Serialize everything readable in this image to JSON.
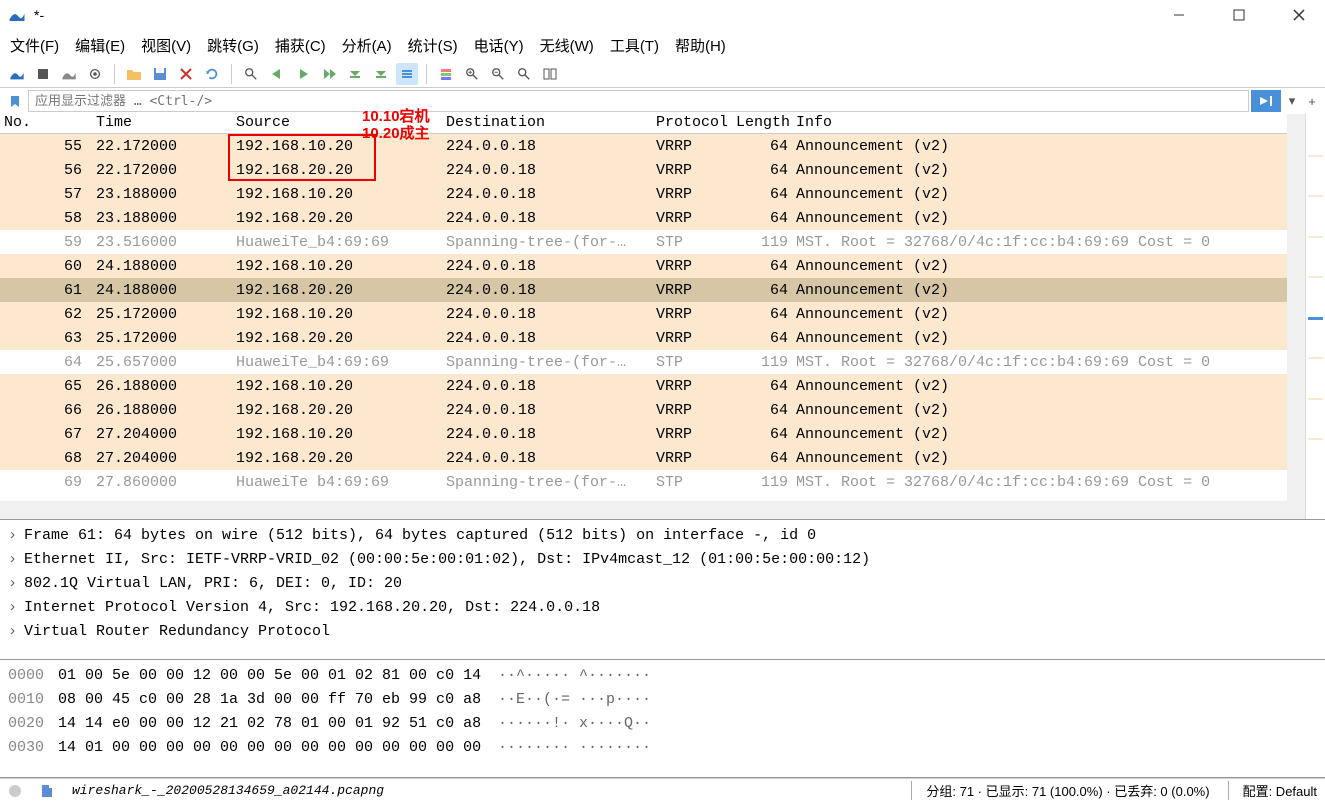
{
  "window": {
    "title": "*-"
  },
  "menu": [
    "文件(F)",
    "编辑(E)",
    "视图(V)",
    "跳转(G)",
    "捕获(C)",
    "分析(A)",
    "统计(S)",
    "电话(Y)",
    "无线(W)",
    "工具(T)",
    "帮助(H)"
  ],
  "filter": {
    "placeholder": "应用显示过滤器 … <Ctrl-/>"
  },
  "annotation1": "10.10宕机",
  "annotation2": "10.20成主",
  "columns": {
    "no": "No.",
    "time": "Time",
    "src": "Source",
    "dst": "Destination",
    "proto": "Protocol",
    "len": "Length",
    "info": "Info"
  },
  "packets": [
    {
      "no": 55,
      "time": "22.172000",
      "src": "192.168.10.20",
      "dst": "224.0.0.18",
      "proto": "VRRP",
      "len": 64,
      "info": "Announcement (v2)",
      "cls": "vrrp",
      "box": true
    },
    {
      "no": 56,
      "time": "22.172000",
      "src": "192.168.20.20",
      "dst": "224.0.0.18",
      "proto": "VRRP",
      "len": 64,
      "info": "Announcement (v2)",
      "cls": "vrrp",
      "box": true
    },
    {
      "no": 57,
      "time": "23.188000",
      "src": "192.168.10.20",
      "dst": "224.0.0.18",
      "proto": "VRRP",
      "len": 64,
      "info": "Announcement (v2)",
      "cls": "vrrp"
    },
    {
      "no": 58,
      "time": "23.188000",
      "src": "192.168.20.20",
      "dst": "224.0.0.18",
      "proto": "VRRP",
      "len": 64,
      "info": "Announcement (v2)",
      "cls": "vrrp"
    },
    {
      "no": 59,
      "time": "23.516000",
      "src": "HuaweiTe_b4:69:69",
      "dst": "Spanning-tree-(for-…",
      "proto": "STP",
      "len": 119,
      "info": "MST. Root = 32768/0/4c:1f:cc:b4:69:69  Cost = 0",
      "cls": "stp"
    },
    {
      "no": 60,
      "time": "24.188000",
      "src": "192.168.10.20",
      "dst": "224.0.0.18",
      "proto": "VRRP",
      "len": 64,
      "info": "Announcement (v2)",
      "cls": "vrrp"
    },
    {
      "no": 61,
      "time": "24.188000",
      "src": "192.168.20.20",
      "dst": "224.0.0.18",
      "proto": "VRRP",
      "len": 64,
      "info": "Announcement (v2)",
      "cls": "vrrp",
      "sel": true
    },
    {
      "no": 62,
      "time": "25.172000",
      "src": "192.168.10.20",
      "dst": "224.0.0.18",
      "proto": "VRRP",
      "len": 64,
      "info": "Announcement (v2)",
      "cls": "vrrp"
    },
    {
      "no": 63,
      "time": "25.172000",
      "src": "192.168.20.20",
      "dst": "224.0.0.18",
      "proto": "VRRP",
      "len": 64,
      "info": "Announcement (v2)",
      "cls": "vrrp"
    },
    {
      "no": 64,
      "time": "25.657000",
      "src": "HuaweiTe_b4:69:69",
      "dst": "Spanning-tree-(for-…",
      "proto": "STP",
      "len": 119,
      "info": "MST. Root = 32768/0/4c:1f:cc:b4:69:69  Cost = 0",
      "cls": "stp"
    },
    {
      "no": 65,
      "time": "26.188000",
      "src": "192.168.10.20",
      "dst": "224.0.0.18",
      "proto": "VRRP",
      "len": 64,
      "info": "Announcement (v2)",
      "cls": "vrrp"
    },
    {
      "no": 66,
      "time": "26.188000",
      "src": "192.168.20.20",
      "dst": "224.0.0.18",
      "proto": "VRRP",
      "len": 64,
      "info": "Announcement (v2)",
      "cls": "vrrp"
    },
    {
      "no": 67,
      "time": "27.204000",
      "src": "192.168.10.20",
      "dst": "224.0.0.18",
      "proto": "VRRP",
      "len": 64,
      "info": "Announcement (v2)",
      "cls": "vrrp"
    },
    {
      "no": 68,
      "time": "27.204000",
      "src": "192.168.20.20",
      "dst": "224.0.0.18",
      "proto": "VRRP",
      "len": 64,
      "info": "Announcement (v2)",
      "cls": "vrrp"
    },
    {
      "no": 69,
      "time": "27.860000",
      "src": "HuaweiTe b4:69:69",
      "dst": "Spanning-tree-(for-…",
      "proto": "STP",
      "len": 119,
      "info": "MST. Root = 32768/0/4c:1f:cc:b4:69:69  Cost = 0",
      "cls": "stp"
    }
  ],
  "details": [
    "Frame 61: 64 bytes on wire (512 bits), 64 bytes captured (512 bits) on interface -, id 0",
    "Ethernet II, Src: IETF-VRRP-VRID_02 (00:00:5e:00:01:02), Dst: IPv4mcast_12 (01:00:5e:00:00:12)",
    "802.1Q Virtual LAN, PRI: 6, DEI: 0, ID: 20",
    "Internet Protocol Version 4, Src: 192.168.20.20, Dst: 224.0.0.18",
    "Virtual Router Redundancy Protocol"
  ],
  "hex": [
    {
      "off": "0000",
      "b": "01 00 5e 00 00 12 00 00  5e 00 01 02 81 00 c0 14",
      "a": "··^····· ^·······"
    },
    {
      "off": "0010",
      "b": "08 00 45 c0 00 28 1a 3d  00 00 ff 70 eb 99 c0 a8",
      "a": "··E··(·= ···p····"
    },
    {
      "off": "0020",
      "b": "14 14 e0 00 00 12 21 02  78 01 00 01 92 51 c0 a8",
      "a": "······!· x····Q··"
    },
    {
      "off": "0030",
      "b": "14 01 00 00 00 00 00 00  00 00 00 00 00 00 00 00",
      "a": "········ ········"
    }
  ],
  "status": {
    "file": "wireshark_-_20200528134659_a02144.pcapng",
    "packets": "分组: 71 · 已显示: 71 (100.0%) · 已丢弃: 0 (0.0%)",
    "profile": "配置: Default"
  }
}
